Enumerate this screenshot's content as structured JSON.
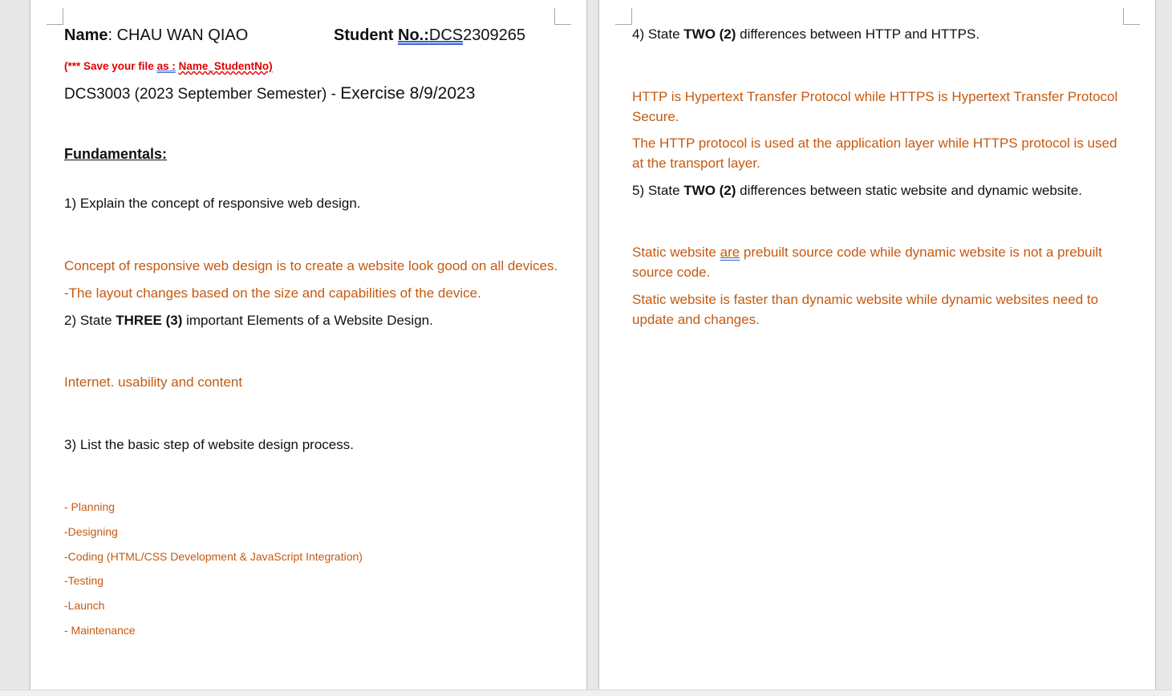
{
  "page1": {
    "name_label": "Name",
    "name_value": ": CHAU WAN QIAO",
    "student_label": "Student ",
    "student_no_label": "No.:",
    "student_no_prefix": "DCS",
    "student_no_value": "2309265",
    "save_note_prefix": "(*** Save your file ",
    "save_note_as": "as :",
    "save_note_space": " ",
    "save_note_name": "Name_StudentNo)",
    "course_line": "DCS3003 (2023 September Semester) - ",
    "exercise_label": "Exercise 8/9/2023",
    "fundamentals_heading": "Fundamentals:",
    "q1": "1) Explain the concept of responsive web design.",
    "a1_line1": "Concept of responsive web design is to create a website look good on all devices.",
    "a1_line2": "-The layout changes based on the size and capabilities of the device.",
    "q2_prefix": "2) State ",
    "q2_bold": "THREE (3)",
    "q2_suffix": " important Elements of a Website Design.",
    "a2": "Internet. usability and content",
    "q3": "3) List the basic step of website design process.",
    "a3_steps": [
      "- Planning",
      "-Designing",
      "-Coding (HTML/CSS Development & JavaScript Integration)",
      "-Testing",
      "-Launch",
      "- Maintenance"
    ]
  },
  "page2": {
    "q4_prefix": "4) State ",
    "q4_bold": "TWO (2)",
    "q4_suffix": " differences between HTTP and HTTPS.",
    "a4_p1": "HTTP is Hypertext Transfer Protocol while HTTPS is Hypertext Transfer Protocol Secure.",
    "a4_p2": "The HTTP protocol is used at the application layer while HTTPS protocol is used at the transport layer.",
    "q5_prefix": "5) State ",
    "q5_bold": "TWO (2)",
    "q5_suffix": " differences between static website and dynamic website.",
    "a5_p1_start": "Static website ",
    "a5_p1_are": "are",
    "a5_p1_rest": " prebuilt source code while dynamic website is not a prebuilt source code.",
    "a5_p2": "Static website is faster than dynamic website while dynamic websites need to update and changes."
  },
  "colors": {
    "answer": "#c55a11",
    "note": "#e00000",
    "text": "#111111",
    "workspace": "#e8e8e8"
  }
}
